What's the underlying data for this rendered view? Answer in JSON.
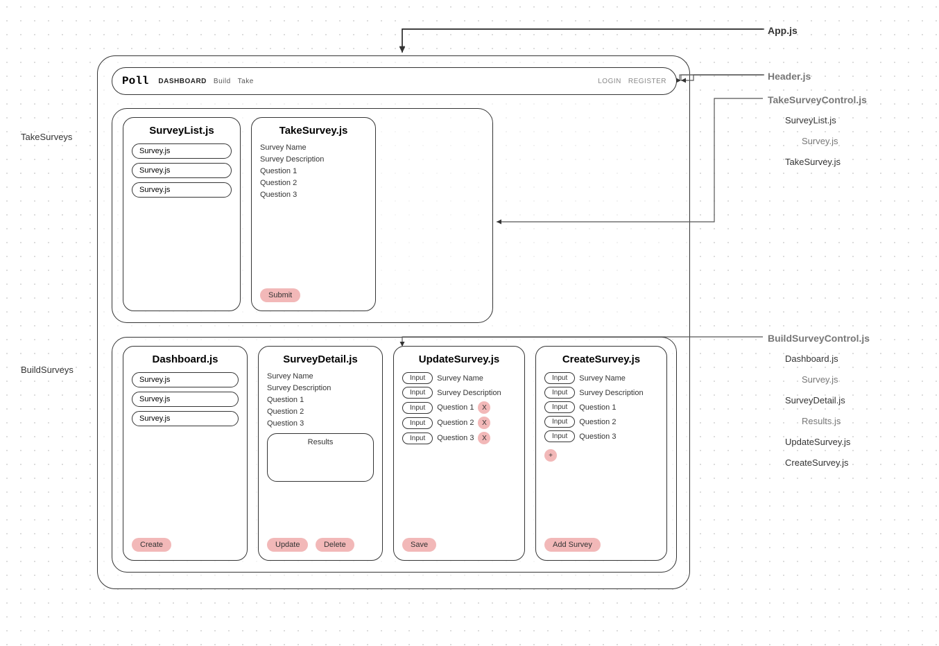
{
  "external_labels": {
    "take_surveys": "TakeSurveys",
    "build_surveys": "BuildSurveys",
    "app": "App.js",
    "header": "Header.js",
    "take_control": "TakeSurveyControl.js",
    "survey_list": "SurveyList.js",
    "survey1": "Survey.js",
    "take_survey": "TakeSurvey.js",
    "build_control": "BuildSurveyControl.js",
    "dashboard": "Dashboard.js",
    "survey2": "Survey.js",
    "survey_detail": "SurveyDetail.js",
    "results": "Results.js",
    "update_survey": "UpdateSurvey.js",
    "create_survey": "CreateSurvey.js"
  },
  "header": {
    "brand": "Poll",
    "nav": {
      "dashboard": "DASHBOARD",
      "build": "Build",
      "take": "Take"
    },
    "auth": {
      "login": "LOGIN",
      "register": "REGISTER"
    }
  },
  "take": {
    "surveylist": {
      "title": "SurveyList.js",
      "items": [
        "Survey.js",
        "Survey.js",
        "Survey.js"
      ]
    },
    "takesurvey": {
      "title": "TakeSurvey.js",
      "name": "Survey Name",
      "desc": "Survey Description",
      "q1": "Question 1",
      "q2": "Question 2",
      "q3": "Question 3",
      "submit": "Submit"
    }
  },
  "build": {
    "dashboard": {
      "title": "Dashboard.js",
      "items": [
        "Survey.js",
        "Survey.js",
        "Survey.js"
      ],
      "create": "Create"
    },
    "detail": {
      "title": "SurveyDetail.js",
      "name": "Survey Name",
      "desc": "Survey Description",
      "q1": "Question 1",
      "q2": "Question 2",
      "q3": "Question 3",
      "results": "Results",
      "update": "Update",
      "delete": "Delete"
    },
    "update": {
      "title": "UpdateSurvey.js",
      "input": "Input",
      "name": "Survey Name",
      "desc": "Survey Description",
      "q1": "Question 1",
      "q2": "Question 2",
      "q3": "Question 3",
      "x": "X",
      "save": "Save"
    },
    "create": {
      "title": "CreateSurvey.js",
      "input": "Input",
      "name": "Survey Name",
      "desc": "Survey Description",
      "q1": "Question 1",
      "q2": "Question 2",
      "q3": "Question 3",
      "plus": "+",
      "add": "Add Survey"
    }
  }
}
